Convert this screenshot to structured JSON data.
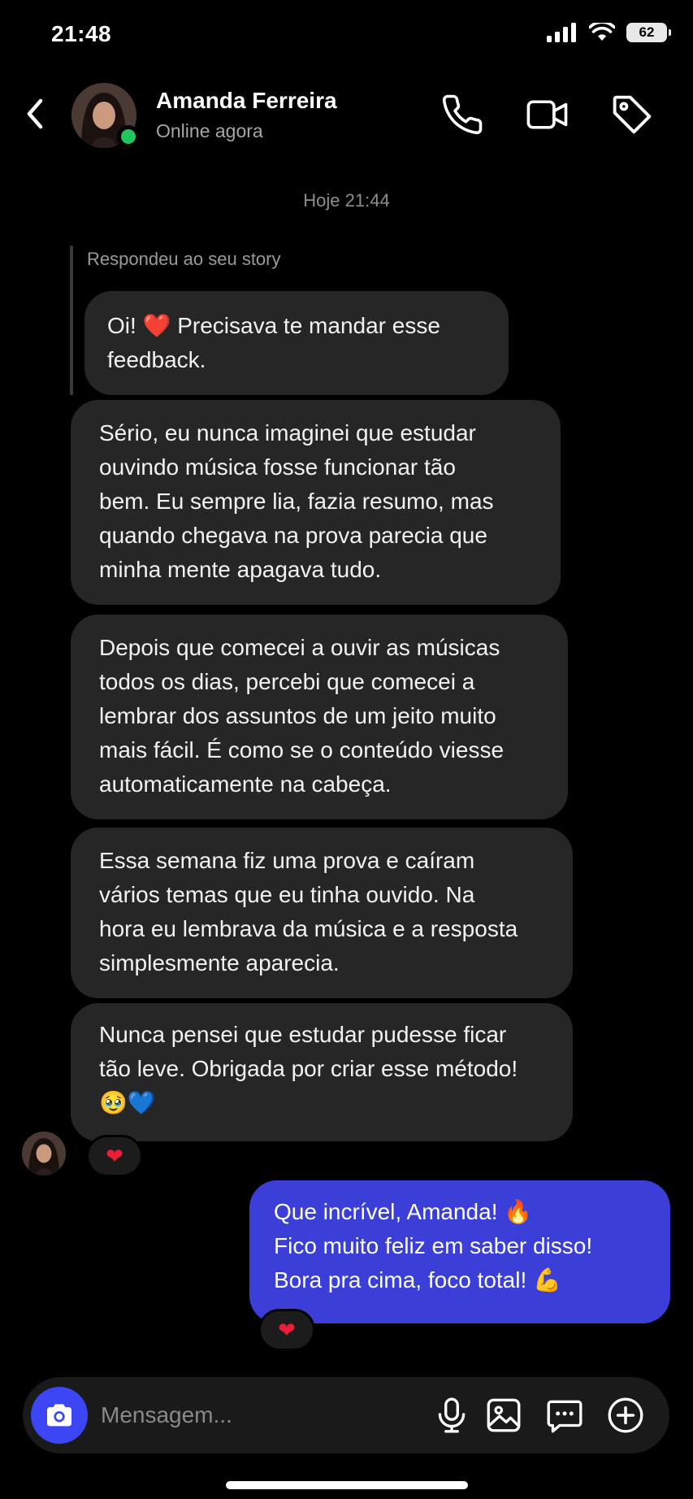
{
  "status_bar": {
    "time": "21:48",
    "battery": "62",
    "icons": [
      "cellular-signal-icon",
      "wifi-icon",
      "battery-icon"
    ]
  },
  "header": {
    "contact_name": "Amanda Ferreira",
    "contact_status": "Online agora",
    "icons": [
      "back-chevron-icon",
      "phone-icon",
      "video-camera-icon",
      "tag-icon"
    ]
  },
  "conversation": {
    "date_separator": "Hoje 21:44",
    "story_reply_label": "Respondeu ao seu story",
    "incoming": [
      "Oi! ❤️ Precisava te mandar esse\nfeedback.",
      "Sério, eu nunca imaginei que estudar\nouvindo música fosse funcionar tão\nbem. Eu sempre lia, fazia resumo, mas\nquando chegava na prova parecia que\nminha mente apagava tudo.",
      "Depois que comecei a ouvir as músicas\ntodos os dias, percebi que comecei a\nlembrar dos assuntos de um jeito muito\nmais fácil. É como se o conteúdo viesse\nautomaticamente na cabeça.",
      "Essa semana fiz uma prova e caíram\nvários temas que eu tinha ouvido. Na\nhora eu lembrava da música e a resposta\nsimplesmente aparecia.",
      "Nunca pensei que estudar pudesse ficar\ntão leve. Obrigada por criar esse método!\n🥹💙"
    ],
    "incoming_reaction": "❤",
    "outgoing": [
      "Que incrível, Amanda! 🔥\nFico muito feliz em saber disso!\nBora pra cima, foco total! 💪"
    ],
    "outgoing_reaction": "❤"
  },
  "composer": {
    "placeholder": "Mensagem...",
    "icons": [
      "camera-icon",
      "microphone-icon",
      "gallery-icon",
      "sticker-chat-icon",
      "add-plus-icon"
    ]
  },
  "colors": {
    "background": "#000000",
    "incoming_bubble": "#262626",
    "outgoing_bubble": "#3b3fd8",
    "camera_button": "#3d46f5",
    "online_dot": "#22c55e",
    "reaction_heart": "#ee1d36"
  }
}
